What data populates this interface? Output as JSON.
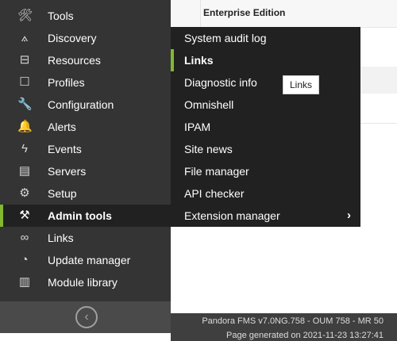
{
  "sidebar": {
    "items": [
      {
        "label": "Tools",
        "icon": "tools-icon",
        "glyph": "🛠"
      },
      {
        "label": "Discovery",
        "icon": "discovery-icon",
        "glyph": "⟑"
      },
      {
        "label": "Resources",
        "icon": "resources-icon",
        "glyph": "⊟"
      },
      {
        "label": "Profiles",
        "icon": "profiles-icon",
        "glyph": "☐"
      },
      {
        "label": "Configuration",
        "icon": "wrench-icon",
        "glyph": "🔧"
      },
      {
        "label": "Alerts",
        "icon": "bell-icon",
        "glyph": "🔔"
      },
      {
        "label": "Events",
        "icon": "events-icon",
        "glyph": "ϟ"
      },
      {
        "label": "Servers",
        "icon": "servers-icon",
        "glyph": "▤"
      },
      {
        "label": "Setup",
        "icon": "gear-icon",
        "glyph": "⚙"
      },
      {
        "label": "Admin tools",
        "icon": "admin-tools-icon",
        "glyph": "⚒",
        "active": true
      },
      {
        "label": "Links",
        "icon": "links-icon",
        "glyph": "∞"
      },
      {
        "label": "Update manager",
        "icon": "update-icon",
        "glyph": "◔"
      },
      {
        "label": "Module library",
        "icon": "library-icon",
        "glyph": "▥"
      }
    ],
    "collapse_icon": "chevron-left-icon"
  },
  "main": {
    "header_title": "Enterprise Edition"
  },
  "submenu": {
    "items": [
      {
        "label": "System audit log"
      },
      {
        "label": "Links",
        "active": true
      },
      {
        "label": "Diagnostic info"
      },
      {
        "label": "Omnishell"
      },
      {
        "label": "IPAM"
      },
      {
        "label": "Site news"
      },
      {
        "label": "File manager"
      },
      {
        "label": "API checker"
      },
      {
        "label": "Extension manager",
        "has_children": true
      }
    ]
  },
  "tooltip": {
    "text": "Links"
  },
  "footer": {
    "version": "Pandora FMS v7.0NG.758 - OUM 758 - MR 50",
    "generated": "Page generated on 2021-11-23 13:27:41"
  },
  "colors": {
    "accent": "#82b92e",
    "sidebar_bg": "#343434",
    "submenu_bg": "#212121"
  }
}
